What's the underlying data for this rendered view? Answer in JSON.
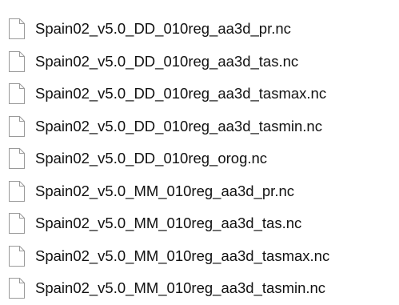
{
  "files": [
    {
      "name": "Spain02_v5.0_DD_010reg_aa3d_pr.nc",
      "icon": "blank-file-icon"
    },
    {
      "name": "Spain02_v5.0_DD_010reg_aa3d_tas.nc",
      "icon": "blank-file-icon"
    },
    {
      "name": "Spain02_v5.0_DD_010reg_aa3d_tasmax.nc",
      "icon": "blank-file-icon"
    },
    {
      "name": "Spain02_v5.0_DD_010reg_aa3d_tasmin.nc",
      "icon": "blank-file-icon"
    },
    {
      "name": "Spain02_v5.0_DD_010reg_orog.nc",
      "icon": "blank-file-icon"
    },
    {
      "name": "Spain02_v5.0_MM_010reg_aa3d_pr.nc",
      "icon": "blank-file-icon"
    },
    {
      "name": "Spain02_v5.0_MM_010reg_aa3d_tas.nc",
      "icon": "blank-file-icon"
    },
    {
      "name": "Spain02_v5.0_MM_010reg_aa3d_tasmax.nc",
      "icon": "blank-file-icon"
    },
    {
      "name": "Spain02_v5.0_MM_010reg_aa3d_tasmin.nc",
      "icon": "blank-file-icon"
    }
  ],
  "colors": {
    "background": "#ffffff",
    "text": "#111111",
    "icon_stroke": "#9a9a9a",
    "icon_fill": "#ffffff"
  }
}
